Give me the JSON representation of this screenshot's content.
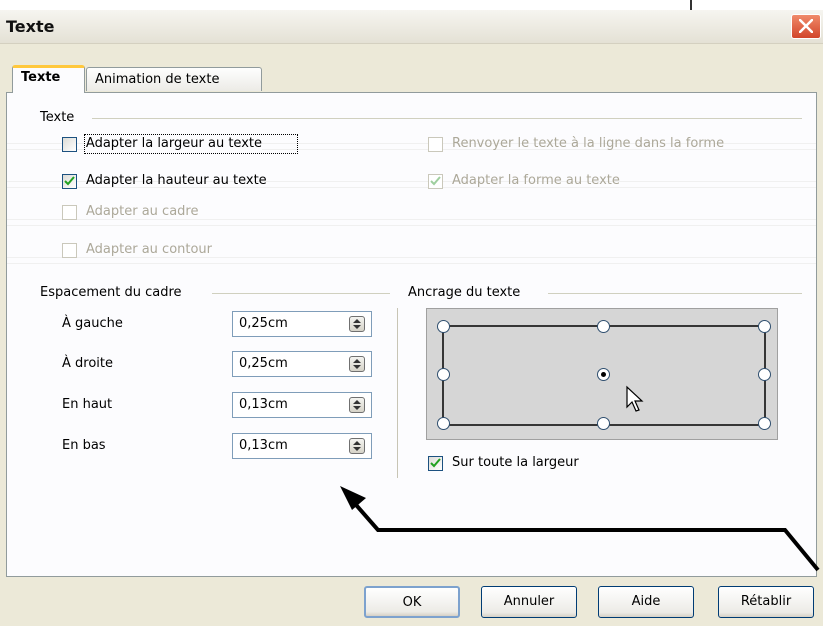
{
  "window": {
    "title": "Texte",
    "close_icon": "close-icon"
  },
  "tabs": [
    {
      "label": "Texte",
      "active": true
    },
    {
      "label": "Animation de texte",
      "active": false
    }
  ],
  "text_group": {
    "title": "Texte",
    "options": [
      {
        "label": "Adapter la largeur au texte",
        "checked": false,
        "enabled": true
      },
      {
        "label": "Adapter la hauteur au texte",
        "checked": true,
        "enabled": true
      },
      {
        "label": "Adapter au cadre",
        "checked": false,
        "enabled": false
      },
      {
        "label": "Adapter au contour",
        "checked": false,
        "enabled": false
      },
      {
        "label": "Renvoyer le texte à la ligne dans la forme",
        "checked": false,
        "enabled": false
      },
      {
        "label": "Adapter la forme au texte",
        "checked": true,
        "enabled": false
      }
    ]
  },
  "spacing_group": {
    "title": "Espacement du cadre",
    "fields": [
      {
        "label": "À gauche",
        "value": "0,25cm"
      },
      {
        "label": "À droite",
        "value": "0,25cm"
      },
      {
        "label": "En haut",
        "value": "0,13cm"
      },
      {
        "label": "En bas",
        "value": "0,13cm"
      }
    ]
  },
  "anchor_group": {
    "title": "Ancrage du texte",
    "selected": "center",
    "full_width": {
      "label": "Sur toute la largeur",
      "checked": true
    }
  },
  "buttons": {
    "ok": "OK",
    "cancel": "Annuler",
    "help": "Aide",
    "reset": "Rétablir"
  },
  "colors": {
    "dialog_bg": "#ece9d8",
    "tab_highlight": "#ffc83c",
    "check_green": "#21a121",
    "close_red": "#d2452b"
  }
}
